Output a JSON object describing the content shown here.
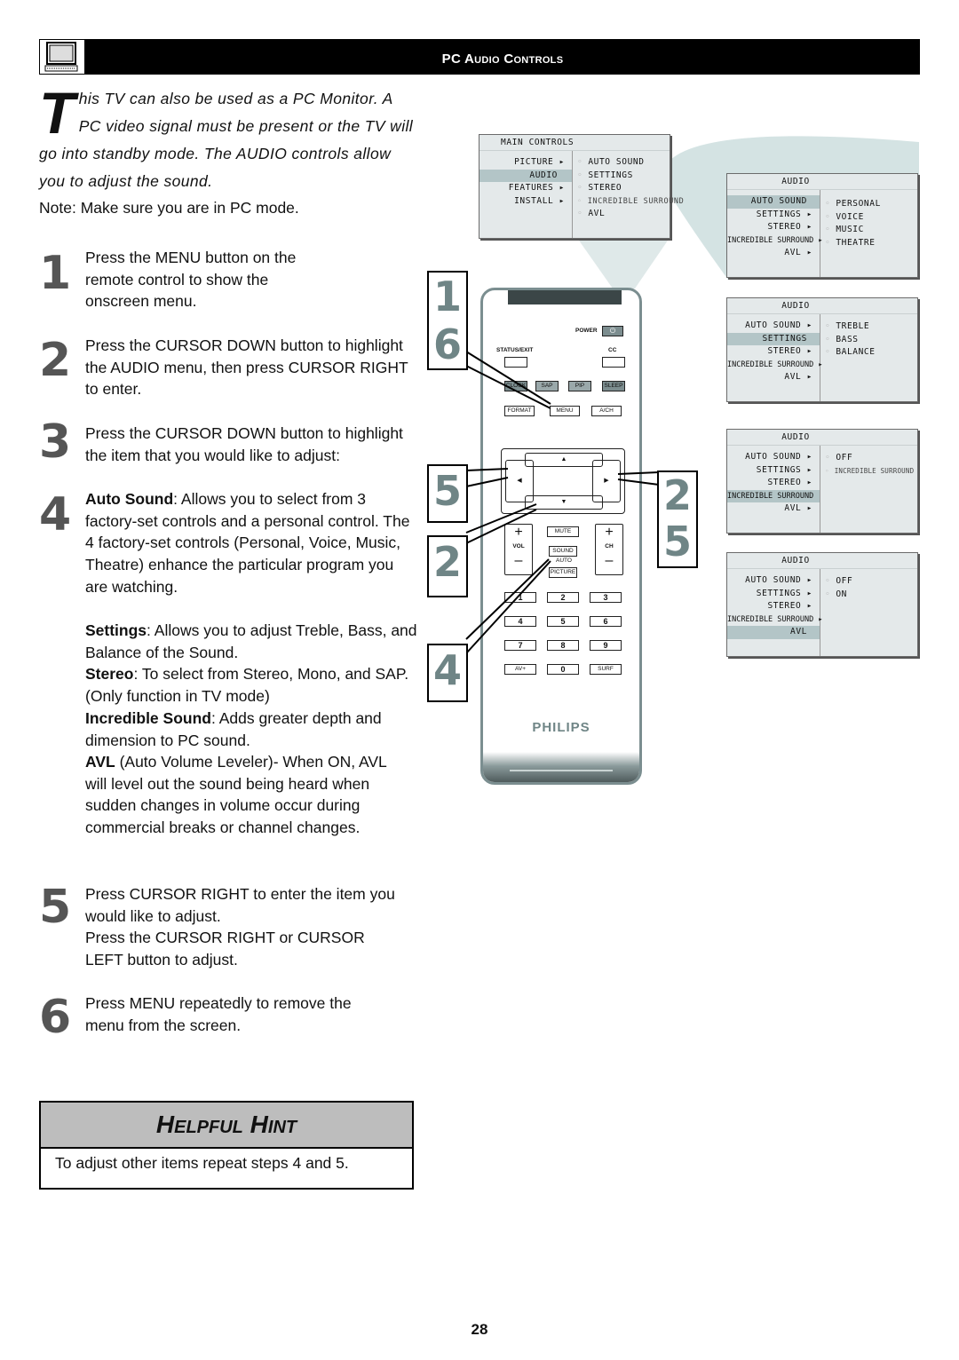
{
  "header": {
    "title": "PC Audio Controls",
    "icon": "pc-monitor-icon"
  },
  "intro": {
    "dropcap": "T",
    "text": "his TV can also be used as a PC Monitor. A PC video signal must be present or the TV will go into standby mode. The AUDIO controls allow you to adjust the sound.",
    "note": "Note: Make sure you are in PC mode."
  },
  "steps": [
    {
      "num": "1",
      "text": "Press the MENU button on the remote control to show the onscreen menu."
    },
    {
      "num": "2",
      "text": "Press the CURSOR DOWN button to highlight the AUDIO menu, then press CURSOR RIGHT to enter."
    },
    {
      "num": "3",
      "text": "Press the CURSOR DOWN  button to highlight the item that you  would like to adjust:"
    },
    {
      "num": "4",
      "items": [
        {
          "term": "Auto Sound",
          "desc": ": Allows you to select from 3 factory-set controls and a personal control. The 4 factory-set controls (Personal, Voice, Music, Theatre) enhance the particular program you are watching."
        },
        {
          "term": "Settings",
          "desc": ": Allows you to adjust Treble, Bass, and Balance of the Sound."
        },
        {
          "term": "Stereo",
          "desc": ": To select from Stereo, Mono, and SAP. (Only function in TV mode)"
        },
        {
          "term": "Incredible Sound",
          "desc": ": Adds greater depth and dimension to PC sound."
        },
        {
          "term": "AVL",
          "desc": " (Auto Volume Leveler)- When ON, AVL will level out the sound being heard when sudden changes in volume occur during commercial breaks or channel changes."
        }
      ]
    },
    {
      "num": "5",
      "text": "Press CURSOR RIGHT to enter the item you would like to adjust.",
      "text2": "Press the CURSOR RIGHT or CURSOR LEFT button to adjust."
    },
    {
      "num": "6",
      "text": "Press MENU repeatedly to remove the menu from the screen."
    }
  ],
  "hint": {
    "title": "Helpful Hint",
    "text": "To adjust other items repeat steps 4 and 5."
  },
  "page_number": "28",
  "menus": {
    "main": {
      "title": "MAIN CONTROLS",
      "left": [
        "PICTURE",
        "AUDIO",
        "FEATURES",
        "INSTALL"
      ],
      "left_arrows": [
        true,
        false,
        true,
        true
      ],
      "selected": 1,
      "right": [
        "AUTO SOUND",
        "SETTINGS",
        "STEREO",
        "INCREDIBLE SURROUND",
        "AVL"
      ]
    },
    "audio1": {
      "title": "AUDIO",
      "left": [
        "AUTO SOUND",
        "SETTINGS",
        "STEREO",
        "INCREDIBLE SURROUND",
        "AVL"
      ],
      "selected": 0,
      "right": [
        "PERSONAL",
        "VOICE",
        "MUSIC",
        "THEATRE"
      ]
    },
    "audio2": {
      "title": "AUDIO",
      "left": [
        "AUTO SOUND",
        "SETTINGS",
        "STEREO",
        "INCREDIBLE SURROUND",
        "AVL"
      ],
      "selected": 1,
      "right": [
        "TREBLE",
        "BASS",
        "BALANCE"
      ]
    },
    "audio3": {
      "title": "AUDIO",
      "left": [
        "AUTO SOUND",
        "SETTINGS",
        "STEREO",
        "INCREDIBLE SURROUND",
        "AVL"
      ],
      "selected": 3,
      "right": [
        "OFF",
        "INCREDIBLE SURROUND"
      ]
    },
    "audio4": {
      "title": "AUDIO",
      "left": [
        "AUTO SOUND",
        "SETTINGS",
        "STEREO",
        "INCREDIBLE SURROUND",
        "AVL"
      ],
      "selected": 4,
      "right": [
        "OFF",
        "ON"
      ]
    }
  },
  "remote": {
    "power": "POWER",
    "status_exit": "STATUS/EXIT",
    "cc": "CC",
    "row_color": [
      "CLOCK",
      "SAP",
      "PIP",
      "SLEEP"
    ],
    "row_fmt": [
      "FORMAT",
      "MENU",
      "A/CH"
    ],
    "mute": "MUTE",
    "sound": "SOUND",
    "auto": "AUTO",
    "picture": "PICTURE",
    "vol": "VOL",
    "ch": "CH",
    "plus": "+",
    "minus": "–",
    "digits": [
      "1",
      "2",
      "3",
      "4",
      "5",
      "6",
      "7",
      "8",
      "9"
    ],
    "bottom": [
      "AV+",
      "0",
      "SURF"
    ],
    "brand": "PHILIPS",
    "arrows": {
      "up": "▲",
      "down": "▼",
      "left": "◀",
      "right": "▶"
    }
  },
  "callouts": {
    "menu": [
      "1",
      "6"
    ],
    "left": "5",
    "down": "2",
    "sound": "4",
    "right": [
      "2",
      "5"
    ]
  }
}
